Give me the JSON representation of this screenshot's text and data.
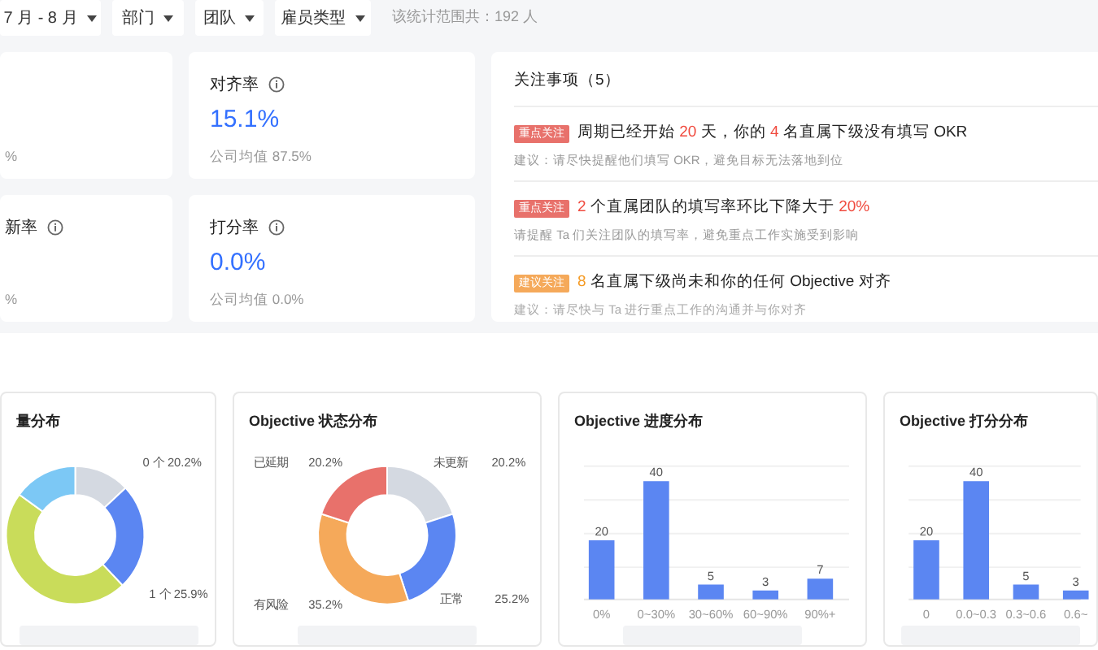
{
  "filters": [
    {
      "label": "7 月 - 8 月"
    },
    {
      "label": "部门"
    },
    {
      "label": "团队"
    },
    {
      "label": "雇员类型"
    }
  ],
  "scope_text": "该统计范围共：192 人",
  "metric_cards": [
    {
      "average": "%"
    },
    {
      "title": "新率",
      "average": "%"
    },
    {
      "title": "对齐率",
      "value": "15.1%",
      "average": "公司均值 87.5%"
    },
    {
      "title": "打分率",
      "value": "0.0%",
      "average": "公司均值 0.0%"
    }
  ],
  "attention": {
    "title": "关注事项（5）",
    "items": [
      {
        "kind": "important",
        "tag": "重点关注",
        "parts": [
          {
            "text": "周期已经开始 ",
            "highlight": false
          },
          {
            "text": "20",
            "highlight": true
          },
          {
            "text": " 天，你的 ",
            "highlight": false
          },
          {
            "text": "4",
            "highlight": true
          },
          {
            "text": " 名直属下级没有填写 OKR",
            "highlight": false
          }
        ],
        "advice": "建议：请尽快提醒他们填写 OKR，避免目标无法落地到位"
      },
      {
        "kind": "important",
        "tag": "重点关注",
        "parts": [
          {
            "text": "2",
            "highlight": true
          },
          {
            "text": " 个直属团队的填写率环比下降大于 ",
            "highlight": false
          },
          {
            "text": "20%",
            "highlight": true
          }
        ],
        "advice": "请提醒 Ta 们关注团队的填写率，避免重点工作实施受到影响"
      },
      {
        "kind": "suggested",
        "tag": "建议关注",
        "parts": [
          {
            "text": "8",
            "highlight": true
          },
          {
            "text": " 名直属下级尚未和你的任何 Objective 对齐",
            "highlight": false
          }
        ],
        "advice": "建议：请尽快与 Ta 进行重点工作的沟通并与你对齐"
      }
    ]
  },
  "charts": [
    {
      "kind": "picture",
      "title": "量分布",
      "labels": [
        "0 个 20.2%",
        "1 个 25.9%"
      ]
    },
    {
      "kind": "chart",
      "title": "Objective 状态分布",
      "chart_data": {
        "type": "donut",
        "categories": [
          "未更新",
          "正常",
          "有风险",
          "已延期"
        ],
        "values": [
          20.2,
          25.2,
          35.2,
          20.2
        ],
        "value_labels": [
          "20.2%",
          "25.2%",
          "35.2%",
          "20.2%"
        ],
        "colors": [
          "#d4d9e1",
          "#5b86f2",
          "#f5a95a",
          "#e8716b"
        ]
      }
    },
    {
      "kind": "chart",
      "title": "Objective 进度分布",
      "chart_data": {
        "type": "bar",
        "categories": [
          "0%",
          "0~30%",
          "30~60%",
          "60~90%",
          "90%+"
        ],
        "values": [
          20,
          40,
          5,
          3,
          7
        ],
        "data_labels": true
      }
    },
    {
      "kind": "chart",
      "title": "Objective 打分分布",
      "chart_data": {
        "type": "bar",
        "categories": [
          "0",
          "0.0~0.3",
          "0.3~0.6",
          "0.6~"
        ],
        "values": [
          20,
          40,
          5,
          3
        ],
        "data_labels": true
      }
    }
  ]
}
